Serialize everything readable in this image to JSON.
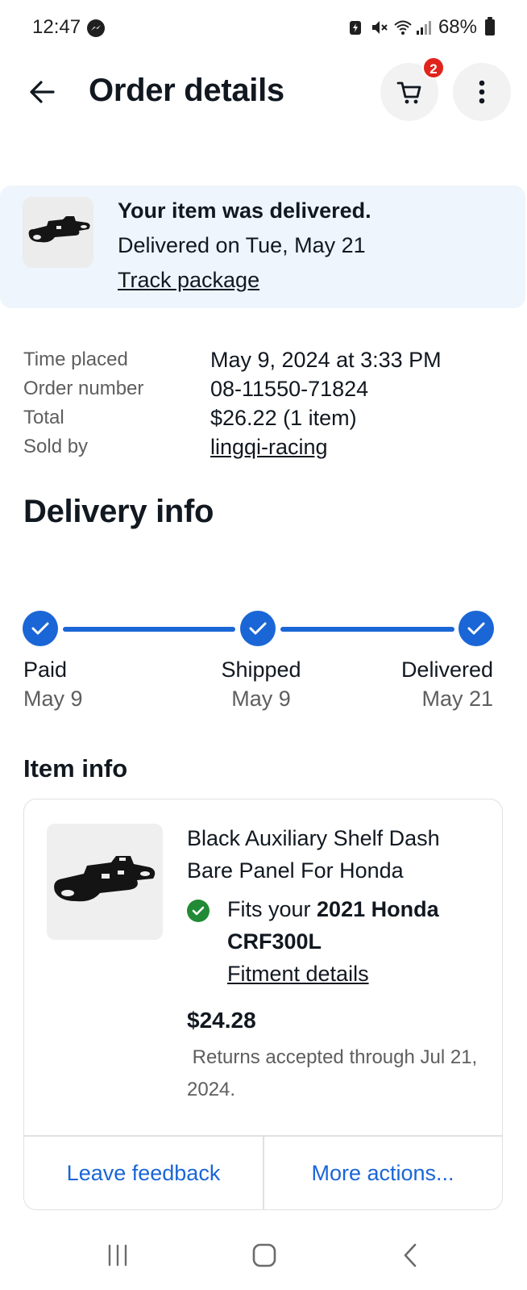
{
  "status_bar": {
    "time": "12:47",
    "battery": "68%"
  },
  "header": {
    "title": "Order details",
    "cart_count": "2"
  },
  "banner": {
    "title": "Your item was delivered.",
    "subtitle": "Delivered on Tue, May 21",
    "link": "Track package"
  },
  "summary": {
    "rows": [
      {
        "key": "Time placed",
        "value": "May 9, 2024 at 3:33 PM"
      },
      {
        "key": "Order number",
        "value": "08-11550-71824"
      },
      {
        "key": "Total",
        "value": "$26.22 (1 item)"
      },
      {
        "key": "Sold by",
        "value": "lingqi-racing"
      }
    ]
  },
  "delivery": {
    "title": "Delivery info",
    "steps": [
      {
        "label": "Paid",
        "date": "May 9"
      },
      {
        "label": "Shipped",
        "date": "May 9"
      },
      {
        "label": "Delivered",
        "date": "May 21"
      }
    ]
  },
  "item": {
    "section_title": "Item info",
    "name": "Black Auxiliary Shelf Dash Bare Panel For Honda",
    "fit_prefix": "Fits your ",
    "fit_vehicle": "2021 Honda CRF300L",
    "fit_link": "Fitment details",
    "price": "$24.28",
    "returns": " Returns accepted through Jul 21, 2024.",
    "actions": {
      "feedback": "Leave feedback",
      "more": "More actions..."
    }
  },
  "colors": {
    "accent_blue": "#1a66d6",
    "banner_bg": "#eef5fc",
    "badge_red": "#e0241c",
    "fit_green": "#218a35"
  }
}
